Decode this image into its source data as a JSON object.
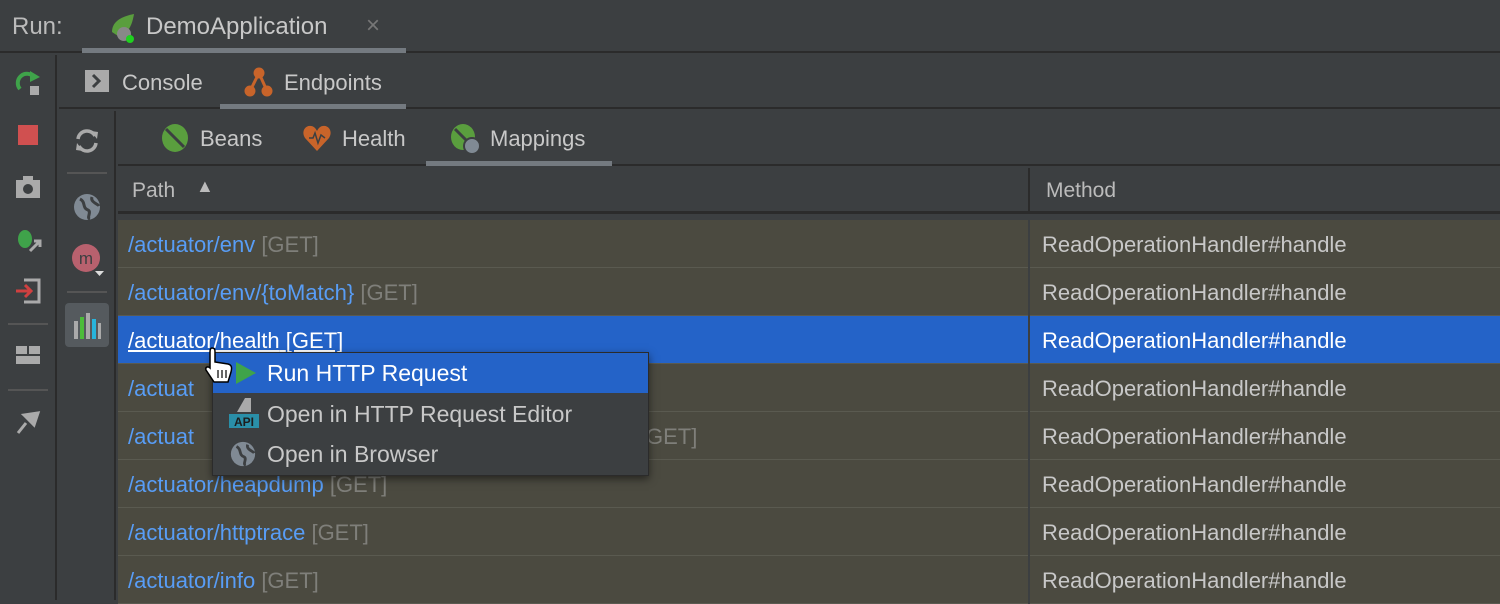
{
  "run": {
    "label": "Run:",
    "tab_title": "DemoApplication",
    "close": "×"
  },
  "tabs": [
    {
      "label": "Console"
    },
    {
      "label": "Endpoints"
    }
  ],
  "subtabs": [
    {
      "label": "Beans"
    },
    {
      "label": "Health"
    },
    {
      "label": "Mappings"
    }
  ],
  "table": {
    "columns": [
      "Path",
      "Method"
    ],
    "rows": [
      {
        "path": "/actuator/env",
        "verb": "[GET]",
        "method": "ReadOperationHandler#handle"
      },
      {
        "path": "/actuator/env/{toMatch}",
        "verb": "[GET]",
        "method": "ReadOperationHandler#handle"
      },
      {
        "path": "/actuator/health",
        "verb": "[GET]",
        "method": "ReadOperationHandler#handle",
        "selected": true
      },
      {
        "path": "/actuat",
        "verb": "",
        "method": "ReadOperationHandler#handle"
      },
      {
        "path": "/actuat",
        "verb": "GET]",
        "method": "ReadOperationHandler#handle"
      },
      {
        "path": "/actuator/heapdump",
        "verb": "[GET]",
        "method": "ReadOperationHandler#handle"
      },
      {
        "path": "/actuator/httptrace",
        "verb": "[GET]",
        "method": "ReadOperationHandler#handle"
      },
      {
        "path": "/actuator/info",
        "verb": "[GET]",
        "method": "ReadOperationHandler#handle"
      }
    ]
  },
  "context_menu": [
    {
      "label": "Run HTTP Request",
      "icon": "play-icon"
    },
    {
      "label": "Open in HTTP Request Editor",
      "icon": "api-icon"
    },
    {
      "label": "Open in Browser",
      "icon": "globe-icon"
    }
  ],
  "colors": {
    "selection": "#2463c8",
    "link": "#589df6",
    "spring_green": "#5a9e3e",
    "endpoint_orange": "#c8642a"
  }
}
